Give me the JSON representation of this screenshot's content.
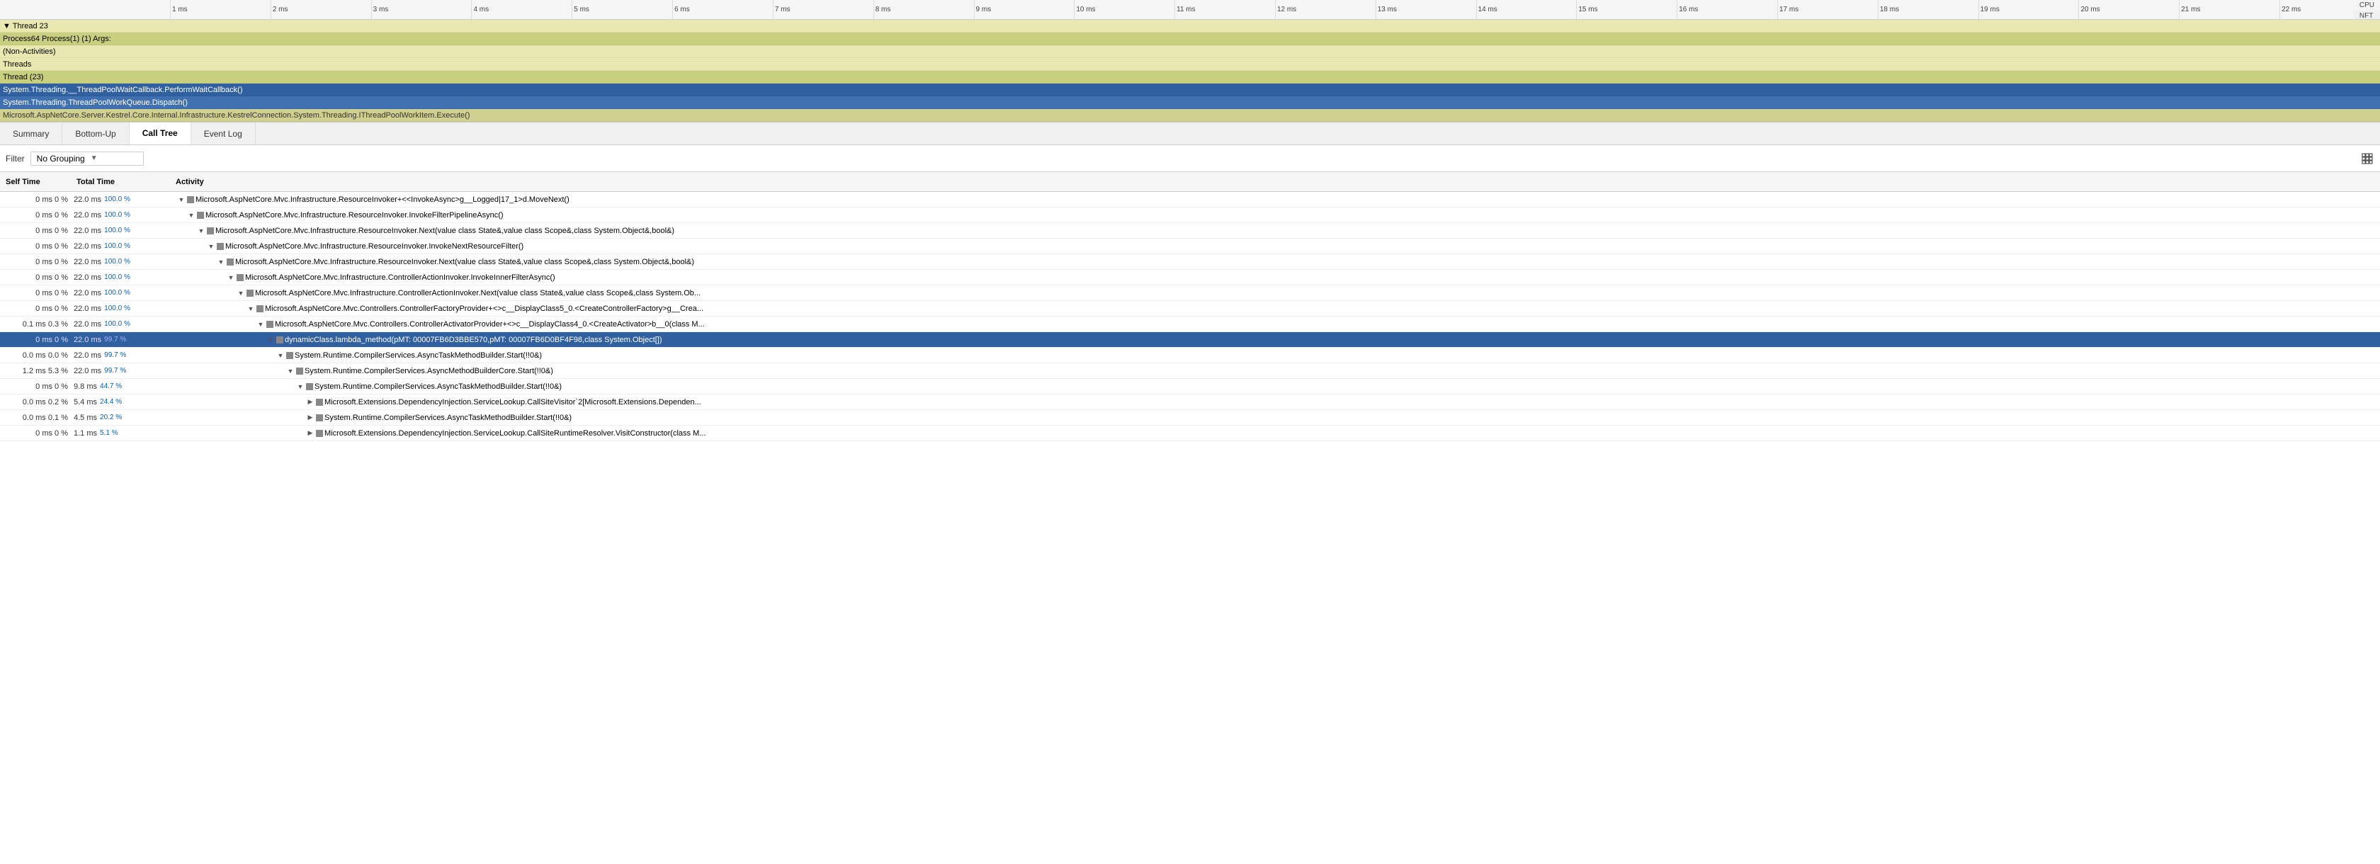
{
  "ruler": {
    "labels": [
      "1 ms",
      "2 ms",
      "3 ms",
      "4 ms",
      "5 ms",
      "6 ms",
      "7 ms",
      "8 ms",
      "9 ms",
      "10 ms",
      "11 ms",
      "12 ms",
      "13 ms",
      "14 ms",
      "15 ms",
      "16 ms",
      "17 ms",
      "18 ms",
      "19 ms",
      "20 ms",
      "21 ms",
      "22 ms"
    ],
    "cpu_label": "CPU",
    "nft_label": "NFT"
  },
  "thread_area": {
    "rows": [
      {
        "label": "▼  Thread 23",
        "indent": 0,
        "style": "normal"
      },
      {
        "label": "Process64 Process(1) (1) Args:",
        "indent": 0,
        "style": "highlighted"
      },
      {
        "label": "(Non-Activities)",
        "indent": 0,
        "style": "normal"
      },
      {
        "label": "Threads",
        "indent": 0,
        "style": "normal"
      },
      {
        "label": "Thread (23)",
        "indent": 0,
        "style": "highlighted"
      },
      {
        "label": "System.Threading.__ThreadPoolWaitCallback.PerformWaitCallback()",
        "indent": 0,
        "style": "selected"
      },
      {
        "label": "System.Threading.ThreadPoolWorkQueue.Dispatch()",
        "indent": 0,
        "style": "selected2"
      },
      {
        "label": "Microsoft.AspNetCore.Server.Kestrel.Core.Internal.Infrastructure.KestrelConnection.System.Threading.IThreadPoolWorkItem.Execute()",
        "indent": 0,
        "style": "faded"
      }
    ]
  },
  "tabs": {
    "items": [
      "Summary",
      "Bottom-Up",
      "Call Tree",
      "Event Log"
    ],
    "active": "Call Tree"
  },
  "filter_bar": {
    "filter_label": "Filter",
    "grouping_label": "No Grouping",
    "settings_icon": "⊞"
  },
  "columns": {
    "self_time": "Self Time",
    "total_time": "Total Time",
    "activity": "Activity"
  },
  "rows": [
    {
      "self_time": "0 ms",
      "self_pct": "0 %",
      "total_ms": "22.0 ms",
      "total_pct": "100.0 %",
      "indent": 0,
      "expand": "▼",
      "icon": true,
      "activity": "Microsoft.AspNetCore.Mvc.Infrastructure.ResourceInvoker+<<InvokeAsync>g__Logged|17_1>d.MoveNext()",
      "style": ""
    },
    {
      "self_time": "0 ms",
      "self_pct": "0 %",
      "total_ms": "22.0 ms",
      "total_pct": "100.0 %",
      "indent": 1,
      "expand": "▼",
      "icon": true,
      "activity": "Microsoft.AspNetCore.Mvc.Infrastructure.ResourceInvoker.InvokeFilterPipelineAsync()",
      "style": ""
    },
    {
      "self_time": "0 ms",
      "self_pct": "0 %",
      "total_ms": "22.0 ms",
      "total_pct": "100.0 %",
      "indent": 2,
      "expand": "▼",
      "icon": true,
      "activity": "Microsoft.AspNetCore.Mvc.Infrastructure.ResourceInvoker.Next(value class State&,value class Scope&,class System.Object&,bool&)",
      "style": ""
    },
    {
      "self_time": "0 ms",
      "self_pct": "0 %",
      "total_ms": "22.0 ms",
      "total_pct": "100.0 %",
      "indent": 3,
      "expand": "▼",
      "icon": true,
      "activity": "Microsoft.AspNetCore.Mvc.Infrastructure.ResourceInvoker.InvokeNextResourceFilter()",
      "style": ""
    },
    {
      "self_time": "0 ms",
      "self_pct": "0 %",
      "total_ms": "22.0 ms",
      "total_pct": "100.0 %",
      "indent": 4,
      "expand": "▼",
      "icon": true,
      "activity": "Microsoft.AspNetCore.Mvc.Infrastructure.ResourceInvoker.Next(value class State&,value class Scope&,class System.Object&,bool&)",
      "style": ""
    },
    {
      "self_time": "0 ms",
      "self_pct": "0 %",
      "total_ms": "22.0 ms",
      "total_pct": "100.0 %",
      "indent": 5,
      "expand": "▼",
      "icon": true,
      "activity": "Microsoft.AspNetCore.Mvc.Infrastructure.ControllerActionInvoker.InvokeInnerFilterAsync()",
      "style": ""
    },
    {
      "self_time": "0 ms",
      "self_pct": "0 %",
      "total_ms": "22.0 ms",
      "total_pct": "100.0 %",
      "indent": 6,
      "expand": "▼",
      "icon": true,
      "activity": "Microsoft.AspNetCore.Mvc.Infrastructure.ControllerActionInvoker.Next(value class State&,value class Scope&,class System.Ob...",
      "style": ""
    },
    {
      "self_time": "0 ms",
      "self_pct": "0 %",
      "total_ms": "22.0 ms",
      "total_pct": "100.0 %",
      "indent": 7,
      "expand": "▼",
      "icon": true,
      "activity": "Microsoft.AspNetCore.Mvc.Controllers.ControllerFactoryProvider+<>c__DisplayClass5_0.<CreateControllerFactory>g__Crea...",
      "style": ""
    },
    {
      "self_time": "0.1 ms",
      "self_pct": "0.3 %",
      "total_ms": "22.0 ms",
      "total_pct": "100.0 %",
      "indent": 8,
      "expand": "▼",
      "icon": true,
      "activity": "Microsoft.AspNetCore.Mvc.Controllers.ControllerActivatorProvider+<>c__DisplayClass4_0.<CreateActivator>b__0(class M...",
      "style": ""
    },
    {
      "self_time": "0 ms",
      "self_pct": "0 %",
      "total_ms": "22.0 ms",
      "total_pct": "99.7 %",
      "indent": 9,
      "expand": "▼",
      "icon": true,
      "activity": "dynamicClass.lambda_method(pMT: 00007FB6D3BBE570,pMT: 00007FB6D0BF4F98,class System.Object[])",
      "style": "selected"
    },
    {
      "self_time": "0.0 ms",
      "self_pct": "0.0 %",
      "total_ms": "22.0 ms",
      "total_pct": "99.7 %",
      "indent": 10,
      "expand": "▼",
      "icon": true,
      "activity": "System.Runtime.CompilerServices.AsyncTaskMethodBuilder.Start(!!0&)",
      "style": ""
    },
    {
      "self_time": "1.2 ms",
      "self_pct": "5.3 %",
      "total_ms": "22.0 ms",
      "total_pct": "99.7 %",
      "indent": 11,
      "expand": "▼",
      "icon": true,
      "activity": "System.Runtime.CompilerServices.AsyncMethodBuilderCore.Start(!!0&)",
      "style": ""
    },
    {
      "self_time": "0 ms",
      "self_pct": "0 %",
      "total_ms": "9.8 ms",
      "total_pct": "44.7 %",
      "indent": 12,
      "expand": "▼",
      "icon": true,
      "activity": "System.Runtime.CompilerServices.AsyncTaskMethodBuilder.Start(!!0&)",
      "style": ""
    },
    {
      "self_time": "0.0 ms",
      "self_pct": "0.2 %",
      "total_ms": "5.4 ms",
      "total_pct": "24.4 %",
      "indent": 13,
      "expand": "▶",
      "icon": true,
      "activity": "Microsoft.Extensions.DependencyInjection.ServiceLookup.CallSiteVisitor`2[Microsoft.Extensions.Dependen...",
      "style": ""
    },
    {
      "self_time": "0.0 ms",
      "self_pct": "0.1 %",
      "total_ms": "4.5 ms",
      "total_pct": "20.2 %",
      "indent": 13,
      "expand": "▶",
      "icon": true,
      "activity": "System.Runtime.CompilerServices.AsyncTaskMethodBuilder.Start(!!0&)",
      "style": ""
    },
    {
      "self_time": "0 ms",
      "self_pct": "0 %",
      "total_ms": "1.1 ms",
      "total_pct": "5.1 %",
      "indent": 13,
      "expand": "▶",
      "icon": true,
      "activity": "Microsoft.Extensions.DependencyInjection.ServiceLookup.CallSiteRuntimeResolver.VisitConstructor(class M...",
      "style": ""
    }
  ]
}
